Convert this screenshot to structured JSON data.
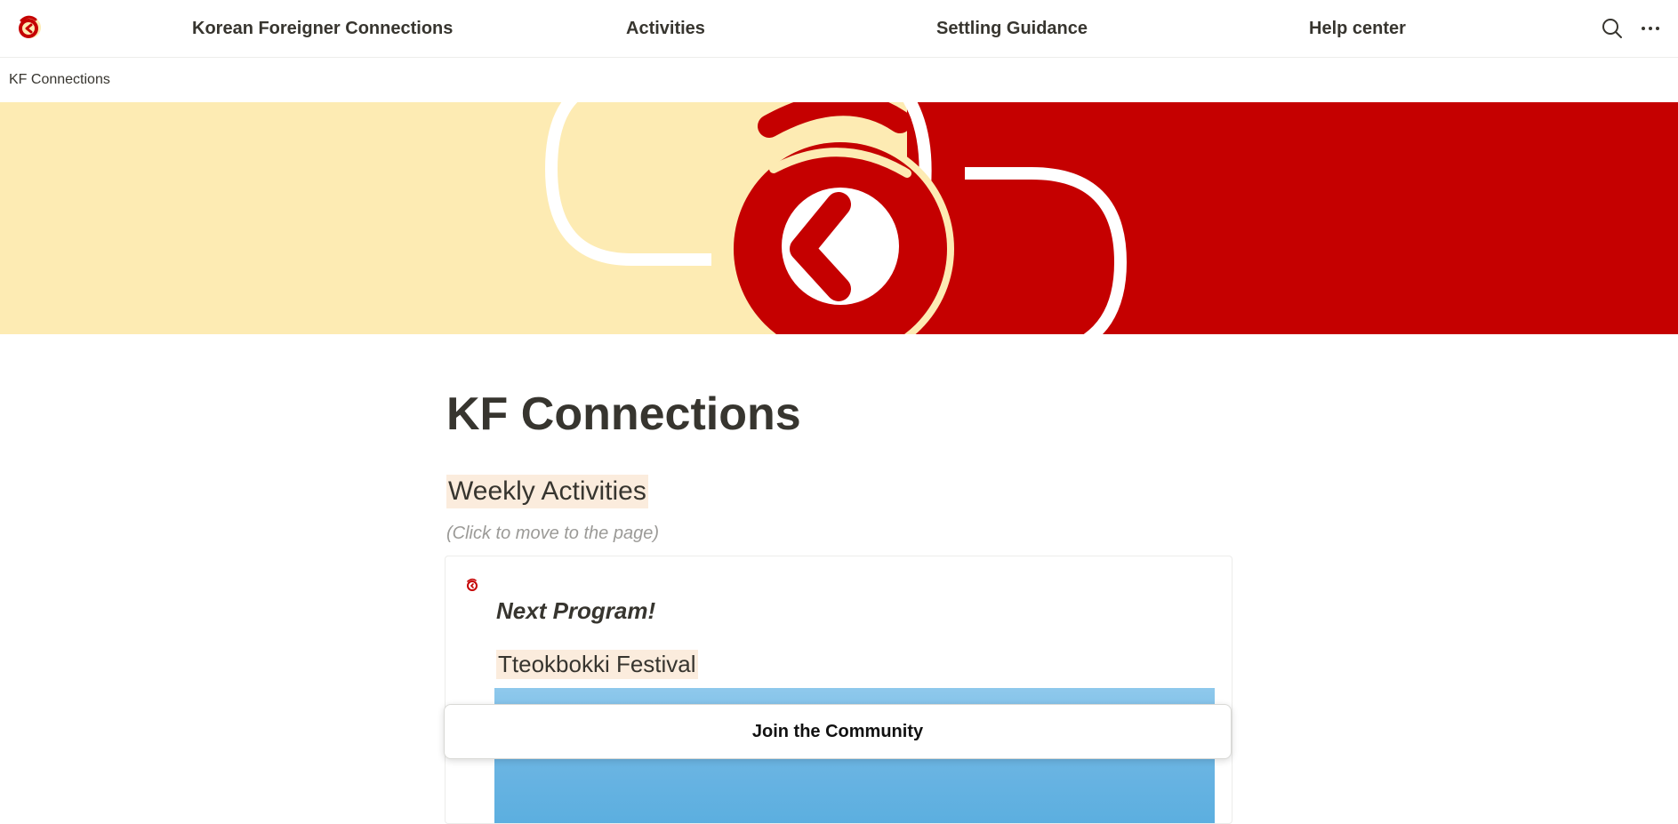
{
  "nav": {
    "links": [
      "Korean Foreigner Connections",
      "Activities",
      "Settling Guidance",
      "Help center"
    ],
    "logo_icon": "kf-logo-icon",
    "search_icon": "search-icon",
    "more_icon": "more-horizontal-icon"
  },
  "breadcrumb": "KF Connections",
  "page": {
    "title": "KF Connections",
    "section_heading": "Weekly Activities",
    "hint": "(Click to move to the page)"
  },
  "callout": {
    "icon": "kf-logo-icon",
    "subtitle": "Next Program!",
    "event_title": "Tteokbokki Festival"
  },
  "cta": {
    "join_label": "Join the Community"
  },
  "colors": {
    "brand_red": "#c50000",
    "banner_cream": "#fdebb3",
    "highlight_bg": "#fbecdd",
    "text": "#37352f",
    "muted": "#9b9a97"
  }
}
